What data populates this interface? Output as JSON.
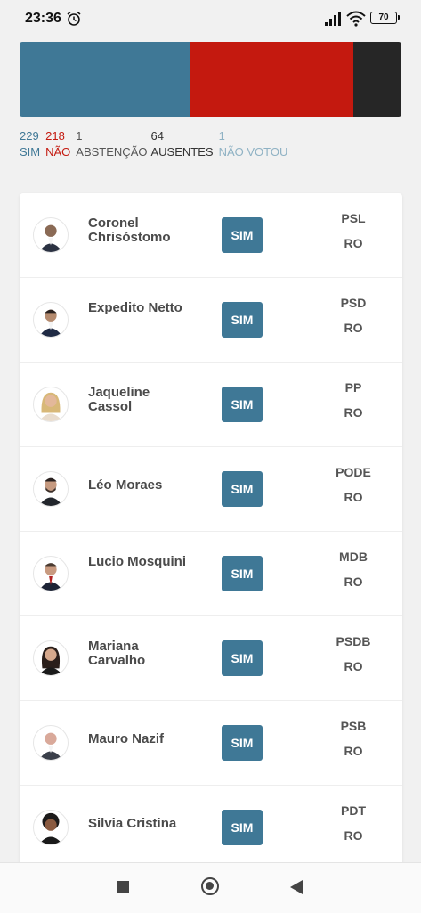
{
  "status": {
    "time": "23:36",
    "battery": "70"
  },
  "summary": {
    "sim_count": "229",
    "sim_label": "SIM",
    "nao_count": "218",
    "nao_label": "NÃO",
    "abs_count": "1",
    "abs_label": "ABSTENÇÃO",
    "aus_count": "64",
    "aus_label": "AUSENTES",
    "nv_count": "1",
    "nv_label": "NÃO VOTOU",
    "colors": {
      "sim": "#3f7896",
      "nao": "#c4190f",
      "ausentes": "#262626"
    }
  },
  "members": [
    {
      "name": "Coronel Chrisóstomo",
      "vote": "SIM",
      "party": "PSL",
      "state": "RO"
    },
    {
      "name": "Expedito Netto",
      "vote": "SIM",
      "party": "PSD",
      "state": "RO"
    },
    {
      "name": "Jaqueline Cassol",
      "vote": "SIM",
      "party": "PP",
      "state": "RO"
    },
    {
      "name": "Léo Moraes",
      "vote": "SIM",
      "party": "PODE",
      "state": "RO"
    },
    {
      "name": "Lucio Mosquini",
      "vote": "SIM",
      "party": "MDB",
      "state": "RO"
    },
    {
      "name": "Mariana Carvalho",
      "vote": "SIM",
      "party": "PSDB",
      "state": "RO"
    },
    {
      "name": "Mauro Nazif",
      "vote": "SIM",
      "party": "PSB",
      "state": "RO"
    },
    {
      "name": "Silvia Cristina",
      "vote": "SIM",
      "party": "PDT",
      "state": "RO"
    }
  ]
}
